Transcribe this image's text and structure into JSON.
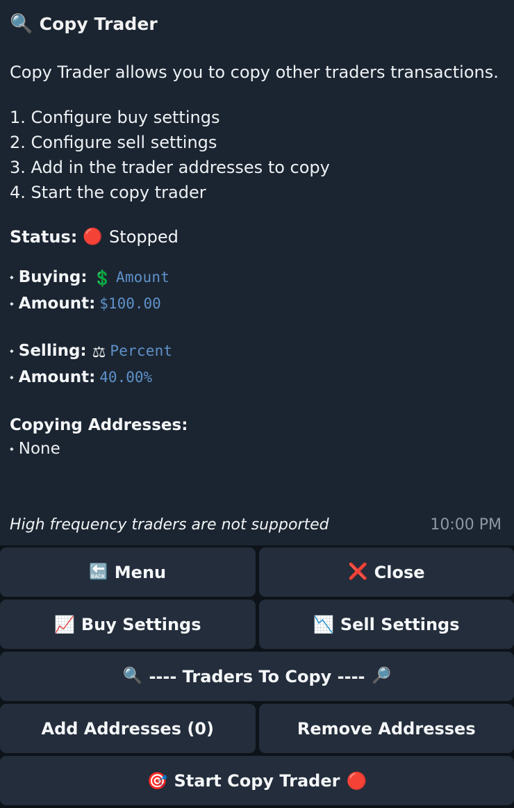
{
  "header": {
    "icon": "🔍",
    "icon_name": "magnifier-icon",
    "title": "Copy Trader"
  },
  "intro": "Copy Trader allows you to copy other traders transactions.",
  "steps": [
    "1. Configure buy settings",
    "2. Configure sell settings",
    "3. Add in the trader addresses to copy",
    "4. Start the copy trader"
  ],
  "status": {
    "label": "Status:",
    "dot": "🔴",
    "value": "Stopped"
  },
  "buy": {
    "bullet": "⬩",
    "key": "Buying:",
    "emoji": "💲",
    "mode": "Amount",
    "amount_key": "Amount:",
    "amount_value": "$100.00"
  },
  "sell": {
    "bullet": "⬩",
    "key": "Selling:",
    "emoji": "⚖",
    "mode": "Percent",
    "amount_key": "Amount:",
    "amount_value": "40.00%"
  },
  "addresses": {
    "heading": "Copying Addresses:",
    "bullet": "⬩",
    "value": "None"
  },
  "footnote": "High frequency traders are not supported",
  "clock": "10:00 PM",
  "buttons": {
    "menu": {
      "glyph": "🔙",
      "label": "Menu"
    },
    "close": {
      "glyph": "❌",
      "label": "Close"
    },
    "buy_settings": {
      "glyph": "📈",
      "label": "Buy Settings"
    },
    "sell_settings": {
      "glyph": "📉",
      "label": "Sell Settings"
    },
    "traders_header": {
      "glyph_left": "🔍",
      "label": "---- Traders To Copy ----",
      "glyph_right": "🔎"
    },
    "add_addresses": {
      "label": "Add Addresses (0)"
    },
    "remove_addresses": {
      "label": "Remove Addresses"
    },
    "start": {
      "glyph_left": "🎯",
      "label": "Start Copy Trader",
      "glyph_right": "🔴"
    }
  },
  "colors": {
    "panel_bg": "#1b2531",
    "app_bg": "#0d1319",
    "button_bg": "#232d3b",
    "accent_blue": "#5f92ca",
    "text": "#f2f4f6",
    "muted": "#8d98a4",
    "danger": "#e31b1b"
  }
}
